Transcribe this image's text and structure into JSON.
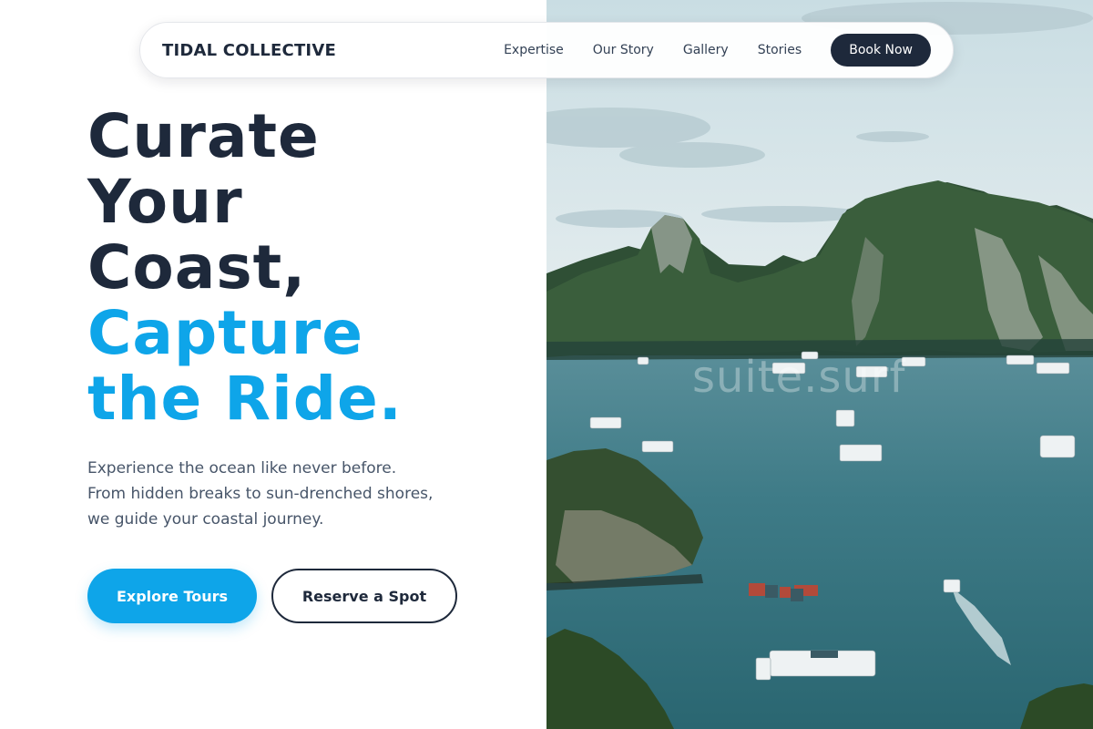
{
  "nav": {
    "brand": "TIDAL COLLECTIVE",
    "links": [
      "Expertise",
      "Our Story",
      "Gallery",
      "Stories"
    ],
    "cta": "Book Now"
  },
  "hero": {
    "title_lines": [
      "Curate",
      "Your",
      "Coast,"
    ],
    "accent_lines": [
      "Capture",
      "the Ride."
    ],
    "subtitle_lines": [
      "Experience the ocean like never before.",
      "From hidden breaks to sun-drenched shores,",
      "we guide your coastal journey."
    ],
    "primary_cta": "Explore Tours",
    "secondary_cta": "Reserve a Spot"
  },
  "photo": {
    "watermark": "suite.surf"
  },
  "colors": {
    "navy": "#1e293b",
    "accent": "#0ea5e9",
    "muted_text": "#475569",
    "water": "#2f6b78"
  }
}
